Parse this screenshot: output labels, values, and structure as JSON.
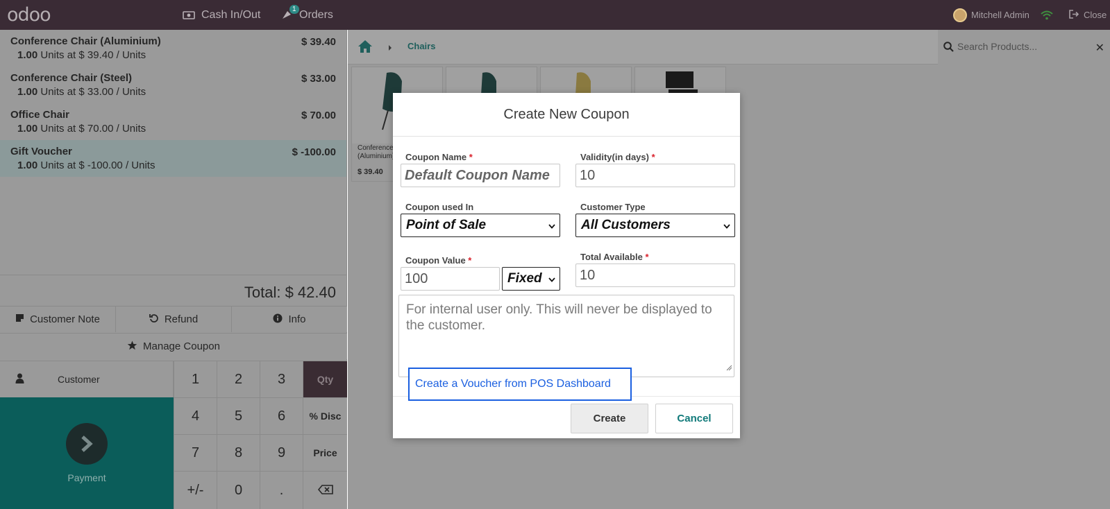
{
  "topbar": {
    "logo": "odoo",
    "cash_label": "Cash In/Out",
    "orders_label": "Orders",
    "orders_badge": "1",
    "user_name": "Mitchell Admin",
    "close_label": "Close"
  },
  "order": {
    "lines": [
      {
        "name": "Conference Chair (Aluminium)",
        "price": "$ 39.40",
        "qty": "1.00",
        "detail": " Units at $ 39.40 / Units"
      },
      {
        "name": "Conference Chair (Steel)",
        "price": "$ 33.00",
        "qty": "1.00",
        "detail": " Units at $ 33.00 / Units"
      },
      {
        "name": "Office Chair",
        "price": "$ 70.00",
        "qty": "1.00",
        "detail": " Units at $ 70.00 / Units"
      },
      {
        "name": "Gift Voucher",
        "price": "$ -100.00",
        "qty": "1.00",
        "detail": " Units at $ -100.00 / Units"
      }
    ],
    "total": "Total: $ 42.40"
  },
  "controls": {
    "customer_note": "Customer Note",
    "refund": "Refund",
    "info": "Info",
    "manage_coupon": "Manage Coupon"
  },
  "numpad": {
    "customer": "Customer",
    "payment": "Payment",
    "keys": [
      "1",
      "2",
      "3",
      "Qty",
      "4",
      "5",
      "6",
      "% Disc",
      "7",
      "8",
      "9",
      "Price",
      "+/-",
      "0",
      "."
    ]
  },
  "products_panel": {
    "breadcrumb": "Chairs",
    "search_placeholder": "Search Products...",
    "products": [
      {
        "name": "Conference Chair (Aluminium)",
        "price": "$ 39.40"
      }
    ]
  },
  "modal": {
    "title": "Create New Coupon",
    "coupon_name_label": "Coupon Name",
    "coupon_name_value": "Default Coupon Name",
    "validity_label": "Validity(in days)",
    "validity_value": "10",
    "used_in_label": "Coupon used In",
    "used_in_value": "Point of Sale",
    "customer_type_label": "Customer Type",
    "customer_type_value": "All Customers",
    "coupon_value_label": "Coupon Value",
    "coupon_value": "100",
    "coupon_value_type": "Fixed",
    "total_available_label": "Total Available",
    "total_available_value": "10",
    "note_placeholder": "For internal user only. This will never be displayed to the customer.",
    "voucher_link": "Create a Voucher from POS Dashboard",
    "create_button": "Create",
    "cancel_button": "Cancel",
    "required_mark": "*"
  },
  "colors": {
    "topbar": "#3a2b35",
    "payment_bg": "#0b5d5a",
    "link_blue": "#1a5fe0",
    "required_red": "#d9212b"
  }
}
